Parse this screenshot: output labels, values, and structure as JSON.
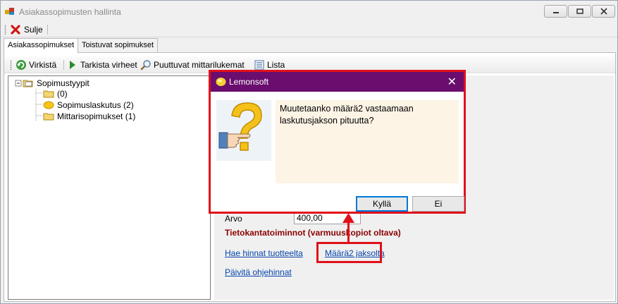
{
  "window": {
    "title": "Asiakassopimusten hallinta"
  },
  "toolbar1": {
    "close_label": "Sulje"
  },
  "tabs": [
    {
      "label": "Asiakassopimukset",
      "active": true
    },
    {
      "label": "Toistuvat sopimukset",
      "active": false
    }
  ],
  "toolbar2": {
    "refresh_label": "Virkistä",
    "check_errors_label": "Tarkista virheet",
    "missing_meters_label": "Puuttuvat mittarilukemat",
    "list_label": "Lista"
  },
  "tree": {
    "root": "Sopimustyypit",
    "children": [
      "(0)",
      "Sopimuslaskutus (2)",
      "Mittarisopimukset (1)"
    ]
  },
  "right_panel": {
    "value_label": "Arvo",
    "value": "400,00",
    "db_ops_heading": "Tietokantatoiminnot (varmuuskopiot oltava)",
    "link_fetch_prices": "Hae hinnat tuotteelta",
    "link_qty2_period": "Määrä2 jaksolta",
    "link_update_prices": "Päivitä ohjehinnat"
  },
  "dialog": {
    "title": "Lemonsoft",
    "message": "Muutetaanko määrä2 vastaamaan laskutusjakson pituutta?",
    "yes_label": "Kyllä",
    "no_label": "Ei"
  },
  "colors": {
    "dialog_title_bg": "#6a0d6e",
    "highlight": "#e0101a",
    "message_bg": "#fdf4e6",
    "link": "#0645ad",
    "heading": "#8b0000"
  }
}
